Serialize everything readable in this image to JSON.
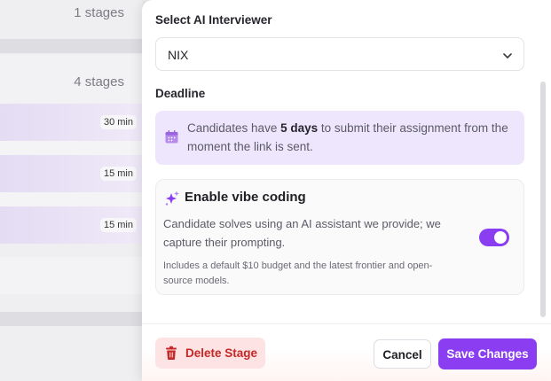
{
  "background": {
    "rows": [
      {
        "stages": "1 stages"
      },
      {
        "stages": "4 stages"
      }
    ],
    "durations": [
      "30 min",
      "15 min",
      "15 min"
    ]
  },
  "drawer": {
    "interviewer_label": "Select AI Interviewer",
    "interviewer_value": "NIX",
    "deadline_label": "Deadline",
    "deadline_notice": {
      "prefix": "Candidates have ",
      "emphasis": "5 days",
      "suffix": " to submit their assignment from the moment the link is sent."
    },
    "vibe": {
      "title": "Enable vibe coding",
      "description": "Candidate solves using an AI assistant we provide; we capture their prompting.",
      "note": "Includes a default $10 budget and the latest frontier and open-source models.",
      "enabled": true
    },
    "footer": {
      "delete_label": "Delete Stage",
      "cancel_label": "Cancel",
      "save_label": "Save Changes"
    },
    "colors": {
      "accent": "#8b3df2",
      "danger": "#c62828",
      "notice_bg": "#eee6fd"
    },
    "icons": [
      "chevron-down-icon",
      "calendar-icon",
      "sparkle-icon",
      "trash-icon"
    ]
  }
}
